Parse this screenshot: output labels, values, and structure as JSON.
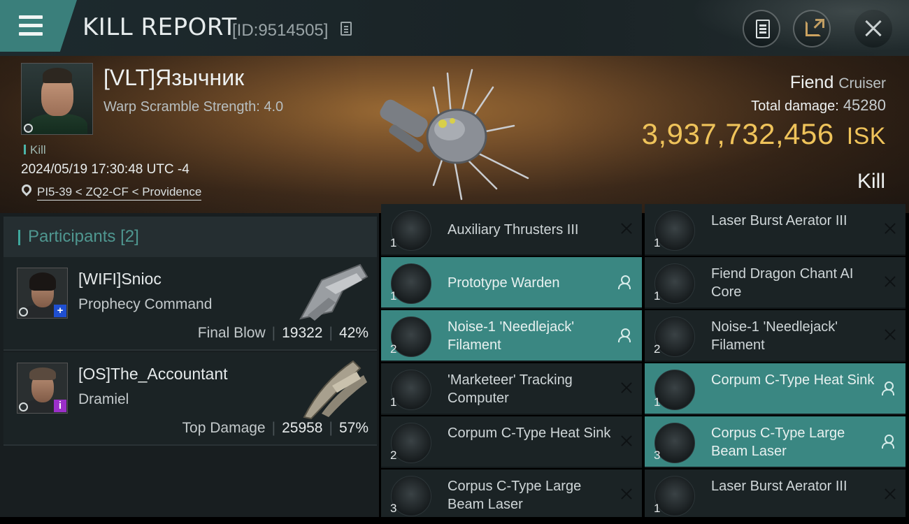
{
  "header": {
    "title": "KILL REPORT",
    "report_id": "[ID:9514505]",
    "icons": [
      "menu-icon",
      "copy-icon",
      "clipboard-icon",
      "share-icon",
      "close-icon"
    ]
  },
  "victim": {
    "name": "[VLT]Язычник",
    "detail": "Warp Scramble Strength: 4.0",
    "type_tag": "Kill",
    "datetime": "2024/05/19 17:30:48 UTC -4",
    "location": "PI5-39 < ZQ2-CF < Providence",
    "ship_name": "Fiend",
    "ship_class": "Cruiser",
    "total_damage_label": "Total damage:",
    "total_damage": "45280",
    "isk_value": "3,937,732,456",
    "isk_unit": "ISK",
    "result": "Kill"
  },
  "participants": {
    "title": "Participants",
    "count": "[2]",
    "items": [
      {
        "name": "[WIFI]Snioc",
        "ship": "Prophecy Command",
        "stat_label": "Final Blow",
        "damage": "19322",
        "percent": "42%",
        "badge": "+",
        "badge_color": "#1f4fd1"
      },
      {
        "name": "[OS]The_Accountant",
        "ship": "Dramiel",
        "stat_label": "Top Damage",
        "damage": "25958",
        "percent": "57%",
        "badge": "i",
        "badge_color": "#9b2fc9"
      }
    ]
  },
  "modules": [
    {
      "name": "Auxiliary Thrusters III",
      "qty": "1",
      "status": "destroyed"
    },
    {
      "name": "Laser Burst Aerator III",
      "qty": "1",
      "status": "destroyed"
    },
    {
      "name": "Prototype  Warden",
      "qty": "1",
      "status": "dropped"
    },
    {
      "name": "Fiend Dragon Chant AI Core",
      "qty": "1",
      "status": "destroyed"
    },
    {
      "name": "Noise-1 'Needlejack' Filament",
      "qty": "2",
      "status": "dropped"
    },
    {
      "name": "Noise-1 'Needlejack' Filament",
      "qty": "2",
      "status": "destroyed"
    },
    {
      "name": "'Marketeer' Tracking Computer",
      "qty": "1",
      "status": "destroyed"
    },
    {
      "name": "Corpum C-Type Heat Sink",
      "qty": "1",
      "status": "dropped"
    },
    {
      "name": "Corpum C-Type Heat Sink",
      "qty": "2",
      "status": "destroyed"
    },
    {
      "name": "Corpus C-Type Large Beam Laser",
      "qty": "3",
      "status": "dropped"
    },
    {
      "name": "Corpus C-Type Large Beam Laser",
      "qty": "3",
      "status": "destroyed"
    },
    {
      "name": "Laser Burst Aerator III",
      "qty": "1",
      "status": "destroyed"
    }
  ],
  "colors": {
    "accent": "#3a7f7b",
    "isk": "#efc35a",
    "dropped_row": "#3a8782",
    "panel": "#1b2325"
  }
}
